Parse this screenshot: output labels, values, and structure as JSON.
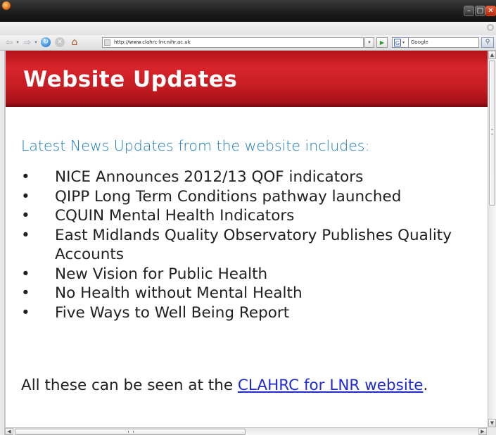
{
  "browser": {
    "url": "http://www.clahrc-lnr.nihr.ac.uk",
    "search_placeholder": "Google",
    "buttons": {
      "minimize": "–",
      "maximize": "□",
      "close": "✕",
      "back": "⇦",
      "forward": "⇨",
      "dropdown": "▾",
      "reload": "↻",
      "stop": "✕",
      "home": "⌂",
      "go": "▶",
      "search_engine": "G",
      "search": "⚲",
      "scroll_up": "▲",
      "scroll_down": "▼",
      "scroll_left": "◀",
      "scroll_right": "▶"
    },
    "icons": [
      "firefox-logo-icon",
      "minimize-icon",
      "maximize-icon",
      "close-icon",
      "back-arrow-icon",
      "forward-arrow-icon",
      "reload-icon",
      "stop-icon",
      "home-icon",
      "go-arrow-icon",
      "google-icon",
      "search-icon"
    ]
  },
  "page": {
    "title": "Website Updates",
    "subtitle": "Latest News Updates from the website includes:",
    "bullet": "•",
    "news_items": [
      "NICE Announces 2012/13 QOF indicators",
      "QIPP Long Term Conditions pathway launched",
      "CQUIN Mental Health Indicators",
      "East Midlands Quality Observatory Publishes Quality Accounts",
      "New Vision for Public Health",
      "No Health without Mental Health",
      "Five Ways to Well Being Report"
    ],
    "footer_prefix": "All these can be seen at the ",
    "footer_link": "CLAHRC for LNR website",
    "footer_suffix": "."
  },
  "colors": {
    "header_red": "#c41c22",
    "subtitle_blue": "#1a7ab8",
    "link_blue": "#1f2bd0",
    "text": "#202020"
  }
}
